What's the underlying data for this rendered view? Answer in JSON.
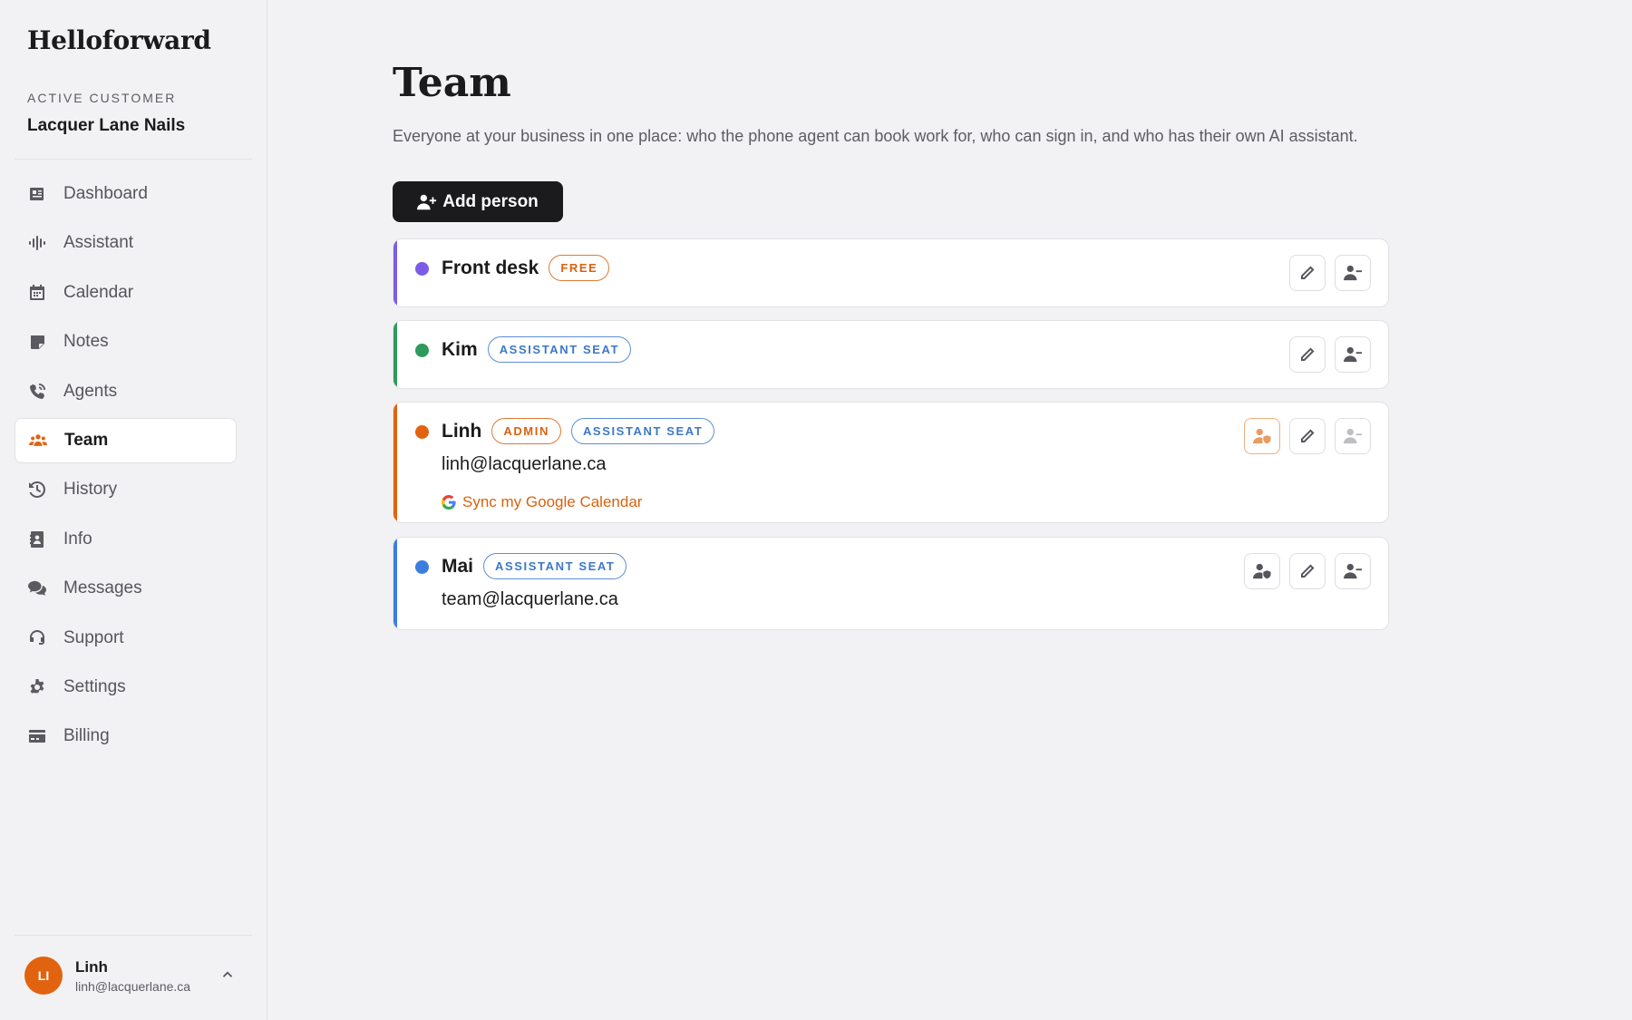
{
  "brand": "Helloforward",
  "customer": {
    "label": "ACTIVE CUSTOMER",
    "name": "Lacquer Lane Nails"
  },
  "nav": [
    {
      "label": "Dashboard",
      "icon": "dashboard-icon",
      "active": false
    },
    {
      "label": "Assistant",
      "icon": "waveform-icon",
      "active": false
    },
    {
      "label": "Calendar",
      "icon": "calendar-icon",
      "active": false
    },
    {
      "label": "Notes",
      "icon": "note-icon",
      "active": false
    },
    {
      "label": "Agents",
      "icon": "phone-icon",
      "active": false
    },
    {
      "label": "Team",
      "icon": "users-icon",
      "active": true
    },
    {
      "label": "History",
      "icon": "history-icon",
      "active": false
    },
    {
      "label": "Info",
      "icon": "contact-card-icon",
      "active": false
    },
    {
      "label": "Messages",
      "icon": "chat-icon",
      "active": false
    },
    {
      "label": "Support",
      "icon": "headset-icon",
      "active": false
    },
    {
      "label": "Settings",
      "icon": "gear-icon",
      "active": false
    },
    {
      "label": "Billing",
      "icon": "credit-card-icon",
      "active": false
    }
  ],
  "user": {
    "initials": "LI",
    "name": "Linh",
    "email": "linh@lacquerlane.ca"
  },
  "page": {
    "title": "Team",
    "description": "Everyone at your business in one place: who the phone agent can book work for, who can sign in, and who has their own AI assistant.",
    "add_button": "Add person"
  },
  "members": [
    {
      "name": "Front desk",
      "color": "#7c5ce6",
      "badges": [
        {
          "text": "FREE",
          "style": "orange"
        }
      ],
      "email": "",
      "sync": ""
    },
    {
      "name": "Kim",
      "color": "#2e9a5e",
      "badges": [
        {
          "text": "ASSISTANT SEAT",
          "style": "blue"
        }
      ],
      "email": "",
      "sync": ""
    },
    {
      "name": "Linh",
      "color": "#e2630f",
      "badges": [
        {
          "text": "ADMIN",
          "style": "orange"
        },
        {
          "text": "ASSISTANT SEAT",
          "style": "blue"
        }
      ],
      "email": "linh@lacquerlane.ca",
      "sync": "Sync my Google Calendar"
    },
    {
      "name": "Mai",
      "color": "#3b7ee0",
      "badges": [
        {
          "text": "ASSISTANT SEAT",
          "style": "blue"
        }
      ],
      "email": "team@lacquerlane.ca",
      "sync": ""
    }
  ]
}
